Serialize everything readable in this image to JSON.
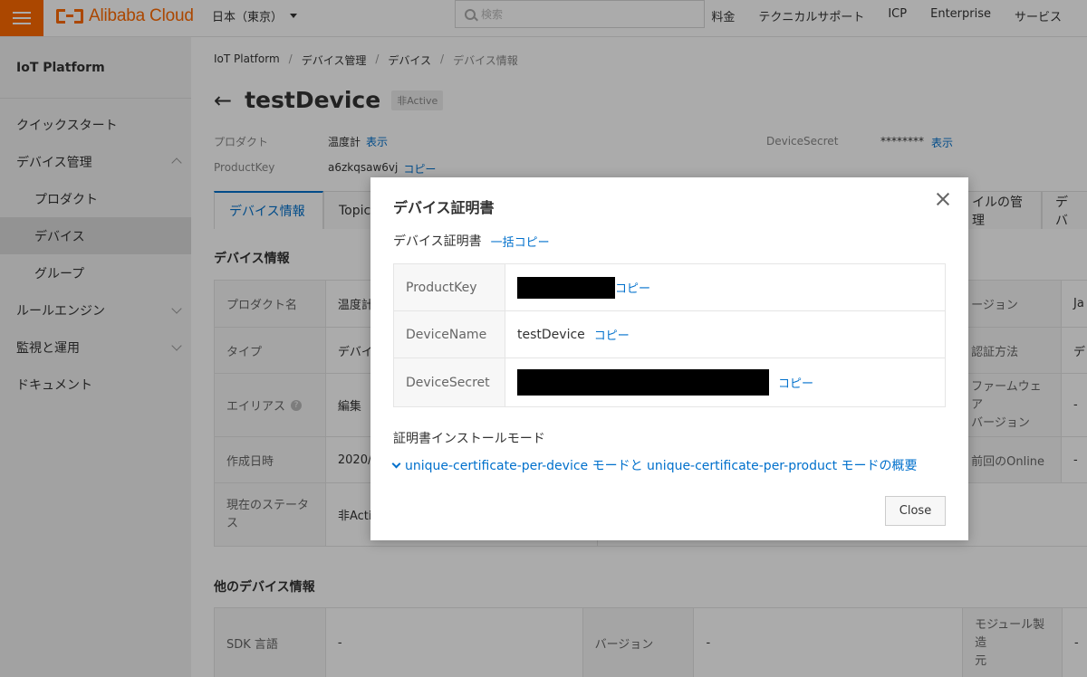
{
  "topbar": {
    "brand": "Alibaba Cloud",
    "region": "日本（東京）",
    "search_placeholder": "検索",
    "nav": [
      "料金",
      "テクニカルサポート",
      "ICP",
      "Enterprise",
      "サービス"
    ]
  },
  "sidebar": {
    "title": "IoT Platform",
    "items": [
      {
        "label": "クイックスタート"
      },
      {
        "label": "デバイス管理"
      },
      {
        "label": "プロダクト"
      },
      {
        "label": "デバイス"
      },
      {
        "label": "グループ"
      },
      {
        "label": "ルールエンジン"
      },
      {
        "label": "監視と運用"
      },
      {
        "label": "ドキュメント"
      }
    ]
  },
  "breadcrumb": [
    "IoT Platform",
    "デバイス管理",
    "デバイス",
    "デバイス情報"
  ],
  "breadcrumb_sep": "/",
  "header": {
    "back_icon": "←",
    "device_name": "testDevice",
    "status": "非Active",
    "product_label": "プロダクト",
    "product_value": "温度計",
    "show_link": "表示",
    "productkey_label": "ProductKey",
    "productkey_value": "a6zkqsaw6vj",
    "copy_link": "コピー",
    "secret_label": "DeviceSecret",
    "secret_value": "********",
    "secret_show": "表示"
  },
  "tabs": {
    "device_info": "デバイス情報",
    "topic": "Topic",
    "file_mgmt": "イルの管理",
    "more": "デバ"
  },
  "info_section": {
    "title": "デバイス情報",
    "rows": [
      {
        "key": "プロダクト名",
        "value": "温度計",
        "right_key": "ージョン",
        "right_value": "Ja"
      },
      {
        "key": "タイプ",
        "value": "デバイ",
        "right_key": "認証方法",
        "right_value": "デ"
      },
      {
        "key": "エイリアス",
        "value": "編集",
        "help": "?",
        "right_key_1": "ファームウェア",
        "right_key_2": "バージョン",
        "right_value": "-"
      },
      {
        "key": "作成日時",
        "value": "2020/0",
        "right_key": "前回のOnline",
        "right_value": "-"
      },
      {
        "key_1": "現在のステータ",
        "key_2": "ス",
        "value": "非Activ"
      }
    ]
  },
  "other_section": {
    "title": "他のデバイス情報",
    "sdk_label": "SDK 言語",
    "sdk_value": "-",
    "version_label": "バージョン",
    "version_value": "-",
    "module_label_1": "モジュール製造",
    "module_label_2": "元",
    "module_value": "-"
  },
  "dialog": {
    "title": "デバイス証明書",
    "cert_label": "デバイス証明書",
    "copy_all": "一括コピー",
    "rows": [
      {
        "key": "ProductKey",
        "value": "",
        "copy": "コピー",
        "redacted": true
      },
      {
        "key": "DeviceName",
        "value": "testDevice",
        "copy": "コピー",
        "redacted": false
      },
      {
        "key": "DeviceSecret",
        "value": "",
        "copy": "コピー",
        "redacted": true
      }
    ],
    "mode_label": "証明書インストールモード",
    "mode_link": "unique-certificate-per-device モードと unique-certificate-per-product モードの概要",
    "close_button": "Close"
  },
  "colors": {
    "brand": "#ff6a00",
    "link": "#0070cc"
  },
  "icons": {
    "menu": "menu-icon",
    "search": "search-icon",
    "close": "close-icon",
    "back": "back-arrow-icon",
    "expand": "chevron-down-icon",
    "help": "help-icon"
  }
}
